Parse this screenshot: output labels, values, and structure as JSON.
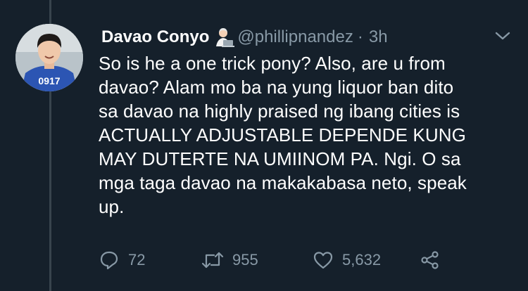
{
  "tweet": {
    "display_name": "Davao Conyo",
    "handle": "@phillipnandez",
    "separator": "·",
    "time": "3h",
    "text_lines": [
      "So is he a one trick pony? Also, are u from",
      "davao? Alam mo ba na yung liquor ban dito",
      "sa davao na highly praised ng ibang cities is",
      "ACTUALLY ADJUSTABLE DEPENDE KUNG",
      "MAY DUTERTE NA UMIINOM PA. Ngi. O sa",
      "mga taga davao na makakabasa neto, speak",
      "up."
    ],
    "avatar_shirt_text": "0917",
    "emoji": "technologist-emoji"
  },
  "actions": {
    "reply_count": "72",
    "retweet_count": "955",
    "like_count": "5,632",
    "icons": [
      "reply-icon",
      "retweet-icon",
      "like-icon",
      "share-icon"
    ]
  },
  "colors": {
    "background": "#15202b",
    "text": "#ffffff",
    "secondary": "#8899a6",
    "thread_line": "#38444d"
  }
}
